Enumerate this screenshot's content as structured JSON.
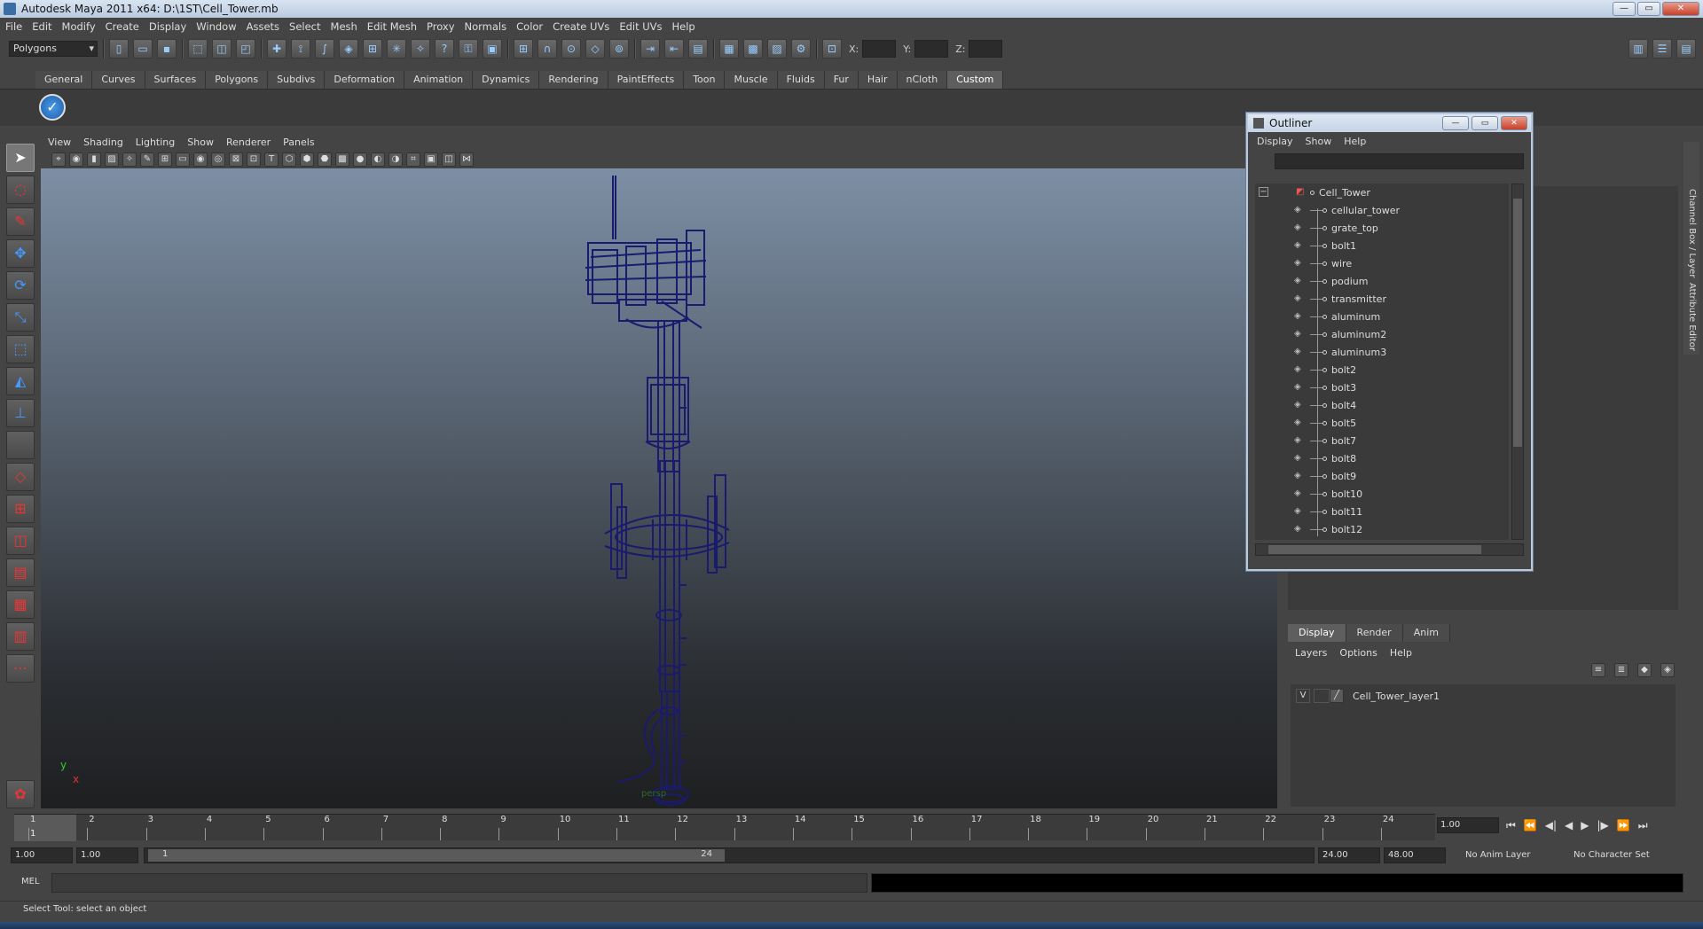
{
  "window": {
    "title": "Autodesk Maya 2011 x64: D:\\1ST\\Cell_Tower.mb",
    "min": "—",
    "max": "▭",
    "close": "✕"
  },
  "menubar": [
    "File",
    "Edit",
    "Modify",
    "Create",
    "Display",
    "Window",
    "Assets",
    "Select",
    "Mesh",
    "Edit Mesh",
    "Proxy",
    "Normals",
    "Color",
    "Create UVs",
    "Edit UVs",
    "Help"
  ],
  "statusline": {
    "mode": "Polygons",
    "x_label": "X:",
    "y_label": "Y:",
    "z_label": "Z:"
  },
  "shelf": {
    "tabs": [
      "General",
      "Curves",
      "Surfaces",
      "Polygons",
      "Subdivs",
      "Deformation",
      "Animation",
      "Dynamics",
      "Rendering",
      "PaintEffects",
      "Toon",
      "Muscle",
      "Fluids",
      "Fur",
      "Hair",
      "nCloth",
      "Custom"
    ],
    "active_tab": "Custom",
    "check_glyph": "✓"
  },
  "viewport": {
    "menu": [
      "View",
      "Shading",
      "Lighting",
      "Show",
      "Renderer",
      "Panels"
    ],
    "camera_label": "persp",
    "axis_y": "y",
    "axis_x": "x",
    "model_color": "#1a1a6e"
  },
  "outliner": {
    "title": "Outliner",
    "menu": [
      "Display",
      "Show",
      "Help"
    ],
    "collapse_glyph": "−",
    "root": "Cell_Tower",
    "items": [
      "cellular_tower",
      "grate_top",
      "bolt1",
      "wire",
      "podium",
      "transmitter",
      "aluminum",
      "aluminum2",
      "aluminum3",
      "bolt2",
      "bolt3",
      "bolt4",
      "bolt5",
      "bolt7",
      "bolt8",
      "bolt9",
      "bolt10",
      "bolt11",
      "bolt12"
    ]
  },
  "layer_editor": {
    "tabs": [
      "Display",
      "Render",
      "Anim"
    ],
    "active_tab": "Display",
    "menu": [
      "Layers",
      "Options",
      "Help"
    ],
    "layer_visibility": "V",
    "layer_name": "Cell_Tower_layer1"
  },
  "side_tabs": {
    "channel_box": "Channel Box / Layer Editor",
    "attribute_editor": "Attribute Editor"
  },
  "timeline": {
    "frames": [
      "1",
      "2",
      "3",
      "4",
      "5",
      "6",
      "7",
      "8",
      "9",
      "10",
      "11",
      "12",
      "13",
      "14",
      "15",
      "16",
      "17",
      "18",
      "19",
      "20",
      "21",
      "22",
      "23",
      "24"
    ],
    "current_frame": "1",
    "current_frame_field": "1.00",
    "playback_glyphs": [
      "⏮",
      "⏪",
      "◀|",
      "◀",
      "▶",
      "|▶",
      "⏩",
      "⏭"
    ]
  },
  "range": {
    "start": "1.00",
    "anim_start": "1.00",
    "range_start": "1",
    "range_end": "24",
    "anim_end": "24.00",
    "end": "48.00",
    "anim_layer": "No Anim Layer",
    "character_set": "No Character Set"
  },
  "command_line": {
    "label": "MEL"
  },
  "help_line": {
    "text": "Select Tool: select an object"
  }
}
